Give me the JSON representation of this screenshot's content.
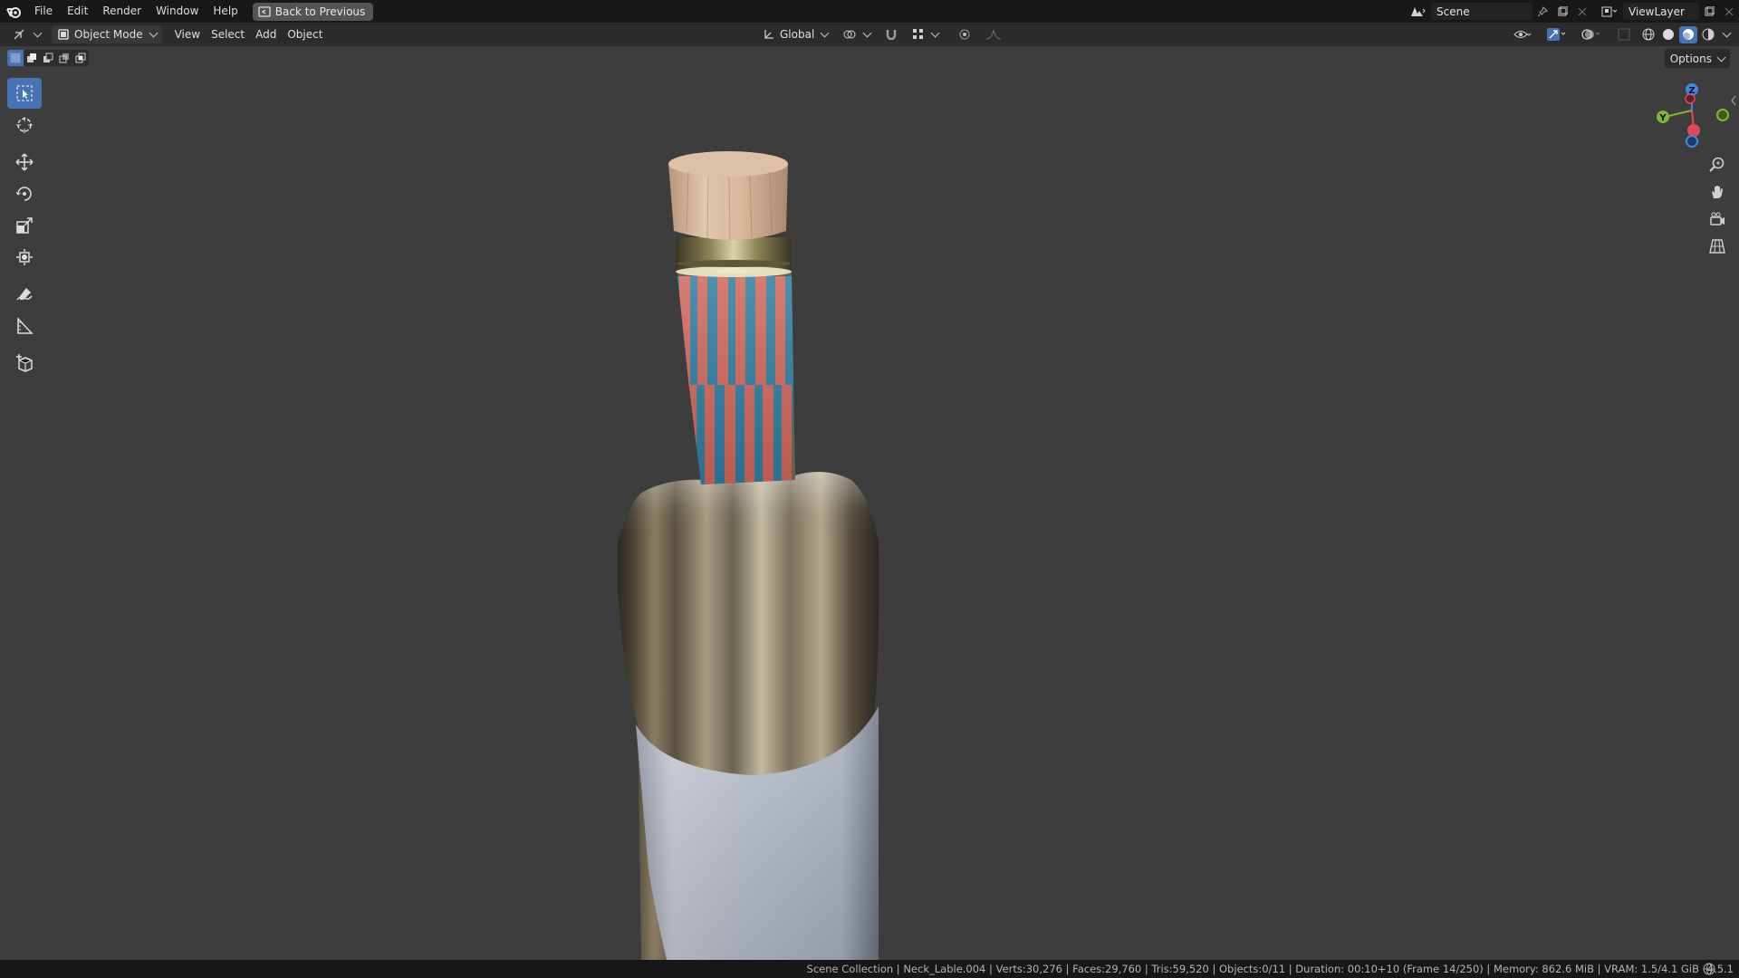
{
  "topbar": {
    "menu": [
      "File",
      "Edit",
      "Render",
      "Window",
      "Help"
    ],
    "back_button": "Back to Previous",
    "scene_name": "Scene",
    "view_layer": "ViewLayer"
  },
  "header": {
    "mode": "Object Mode",
    "menus": [
      "View",
      "Select",
      "Add",
      "Object"
    ],
    "transform_orientation": "Global",
    "options_label": "Options"
  },
  "gizmo": {
    "z_label": "Z",
    "y_label": "Y"
  },
  "status": {
    "text": "Scene Collection | Neck_Lable.004 | Verts:30,276 | Faces:29,760 | Tris:59,520 | Objects:0/11 | Duration: 00:10+10 (Frame 14/250) | Memory: 862.6 MiB | VRAM: 1.5/4.1 GiB",
    "version": "4.5.1"
  },
  "colors": {
    "accent": "#4772b3",
    "viewport_bg": "#3d3d3d",
    "label_stripe_red": "#d2675b",
    "label_stripe_blue": "#2f7ea2",
    "axis_x": "#e2475a",
    "axis_y": "#80b732",
    "axis_z": "#3d88e6"
  }
}
